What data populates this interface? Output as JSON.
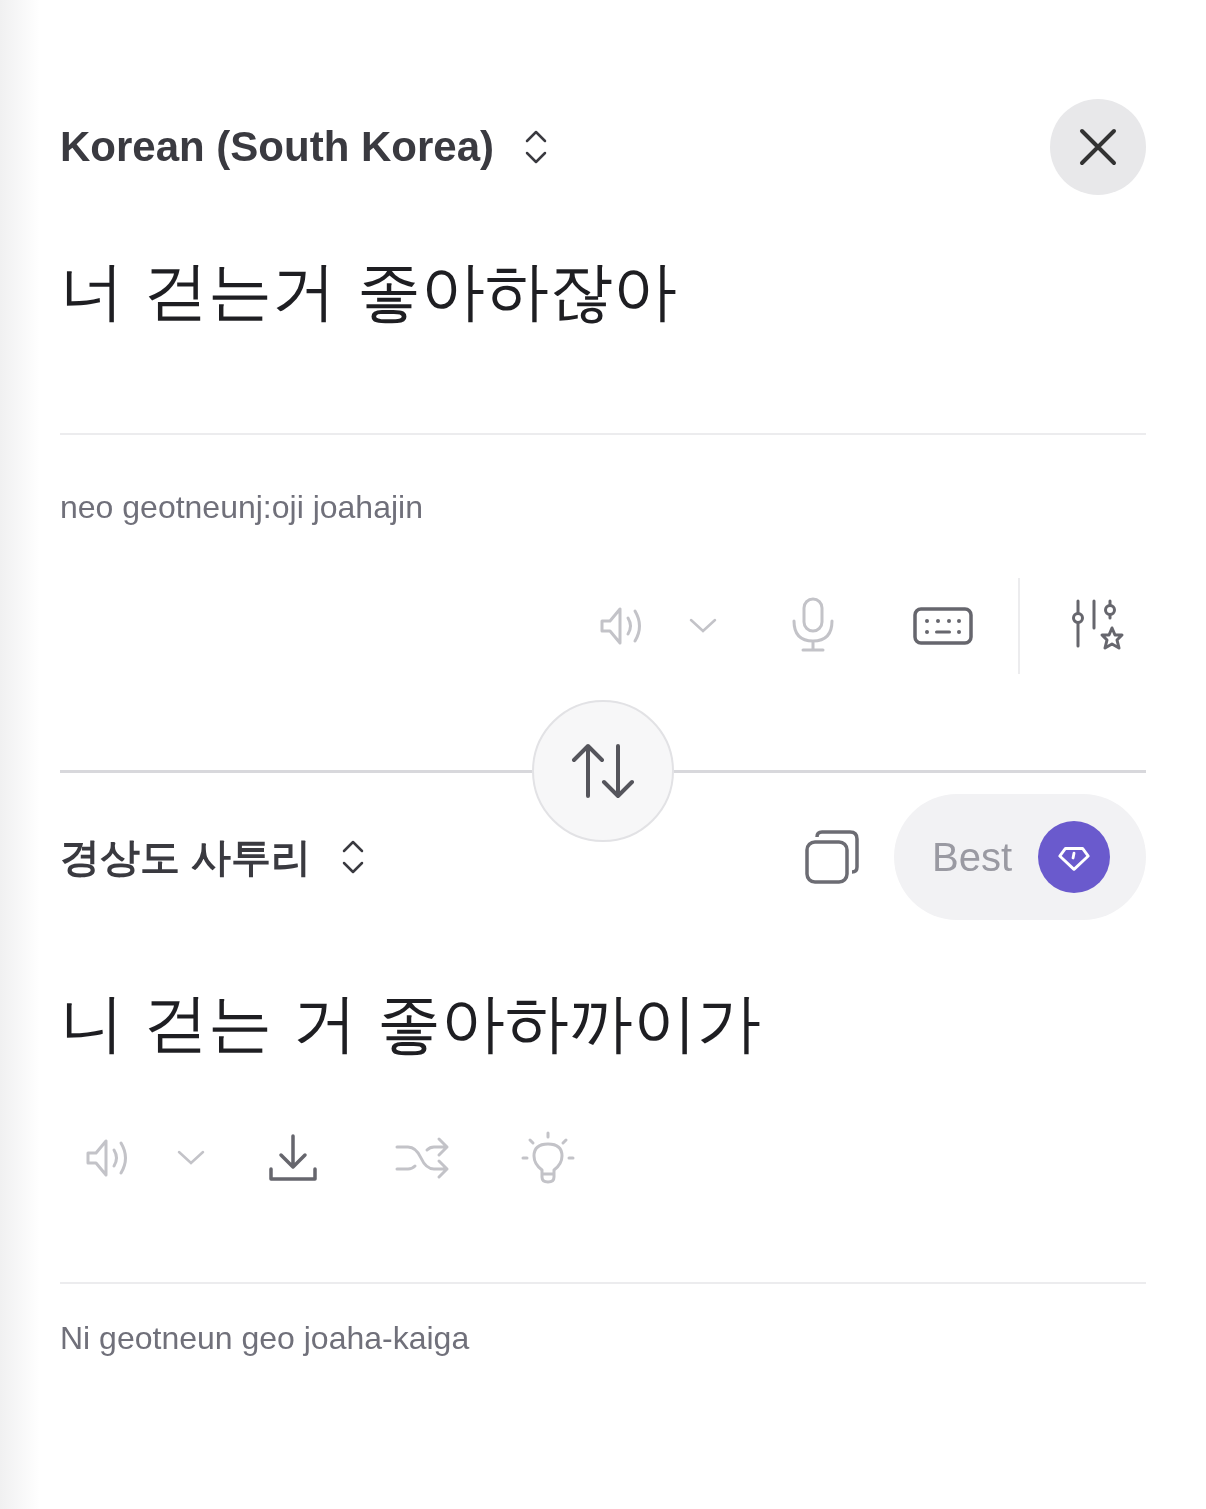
{
  "source": {
    "language": "Korean (South Korea)",
    "text": "너 걷는거 좋아하잖아",
    "romanization": "neo geotneunj:oji joahajin",
    "tools": [
      {
        "kind": "speaker",
        "disabled": true
      },
      {
        "kind": "chevron",
        "disabled": true
      },
      {
        "kind": "mic",
        "disabled": true
      },
      {
        "kind": "keyboard",
        "disabled": false
      },
      {
        "kind": "settings",
        "disabled": false
      }
    ]
  },
  "target": {
    "language": "경상도 사투리",
    "best": {
      "label": "Best"
    },
    "text": "니 걷는 거 좋아하까이가",
    "romanization": "Ni geotneun geo joaha-kaiga",
    "tools": [
      {
        "kind": "speaker",
        "disabled": true
      },
      {
        "kind": "chevron",
        "disabled": true
      },
      {
        "kind": "download",
        "disabled": false
      },
      {
        "kind": "shuffle",
        "disabled": true
      },
      {
        "kind": "bulb",
        "disabled": true
      }
    ]
  }
}
